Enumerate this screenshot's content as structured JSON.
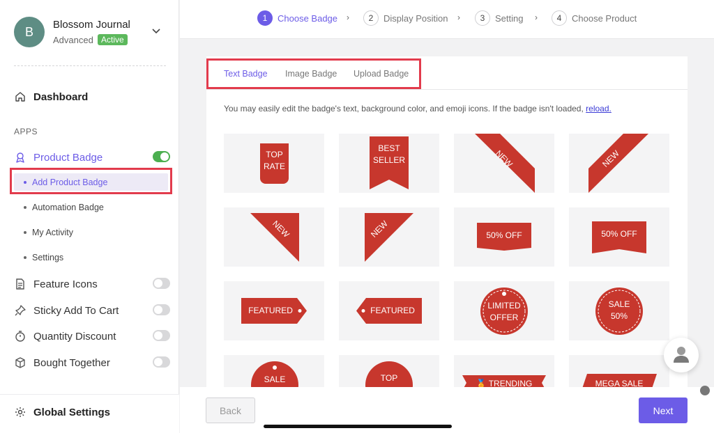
{
  "account": {
    "initial": "B",
    "name": "Blossom Journal",
    "plan": "Advanced",
    "status": "Active"
  },
  "sidebar": {
    "dashboard": "Dashboard",
    "apps_heading": "APPS",
    "product_badge": "Product Badge",
    "product_badge_enabled": true,
    "sub_items": [
      "Add Product Badge",
      "Automation Badge",
      "My Activity",
      "Settings"
    ],
    "apps": [
      {
        "label": "Feature Icons",
        "enabled": false
      },
      {
        "label": "Sticky Add To Cart",
        "enabled": false
      },
      {
        "label": "Quantity Discount",
        "enabled": false
      },
      {
        "label": "Bought Together",
        "enabled": false
      }
    ],
    "global_settings": "Global Settings"
  },
  "steps": [
    {
      "num": "1",
      "label": "Choose Badge",
      "active": true
    },
    {
      "num": "2",
      "label": "Display Position",
      "active": false
    },
    {
      "num": "3",
      "label": "Setting",
      "active": false
    },
    {
      "num": "4",
      "label": "Choose Product",
      "active": false
    }
  ],
  "tabs": [
    "Text Badge",
    "Image Badge",
    "Upload Badge"
  ],
  "note": {
    "text": "You may easily edit the badge's text, background color, and emoji icons. If the badge isn't loaded,",
    "link": "reload."
  },
  "badges": {
    "top_rate": [
      "TOP",
      "RATE"
    ],
    "best_seller": [
      "BEST",
      "SELLER"
    ],
    "new": "NEW",
    "fifty_off": "50% OFF",
    "featured": "FEATURED",
    "limited_offer": [
      "LIMITED",
      "OFFER"
    ],
    "sale_fifty": [
      "SALE",
      "50%"
    ],
    "sale": "SALE",
    "top": "TOP",
    "trending": "TRENDING",
    "mega_sale": "MEGA SALE"
  },
  "buttons": {
    "back": "Back",
    "next": "Next"
  },
  "colors": {
    "accent": "#6c5ce7",
    "badge_red": "#c7372d",
    "highlight": "#e23b4c",
    "toggle_on": "#4caf50"
  }
}
